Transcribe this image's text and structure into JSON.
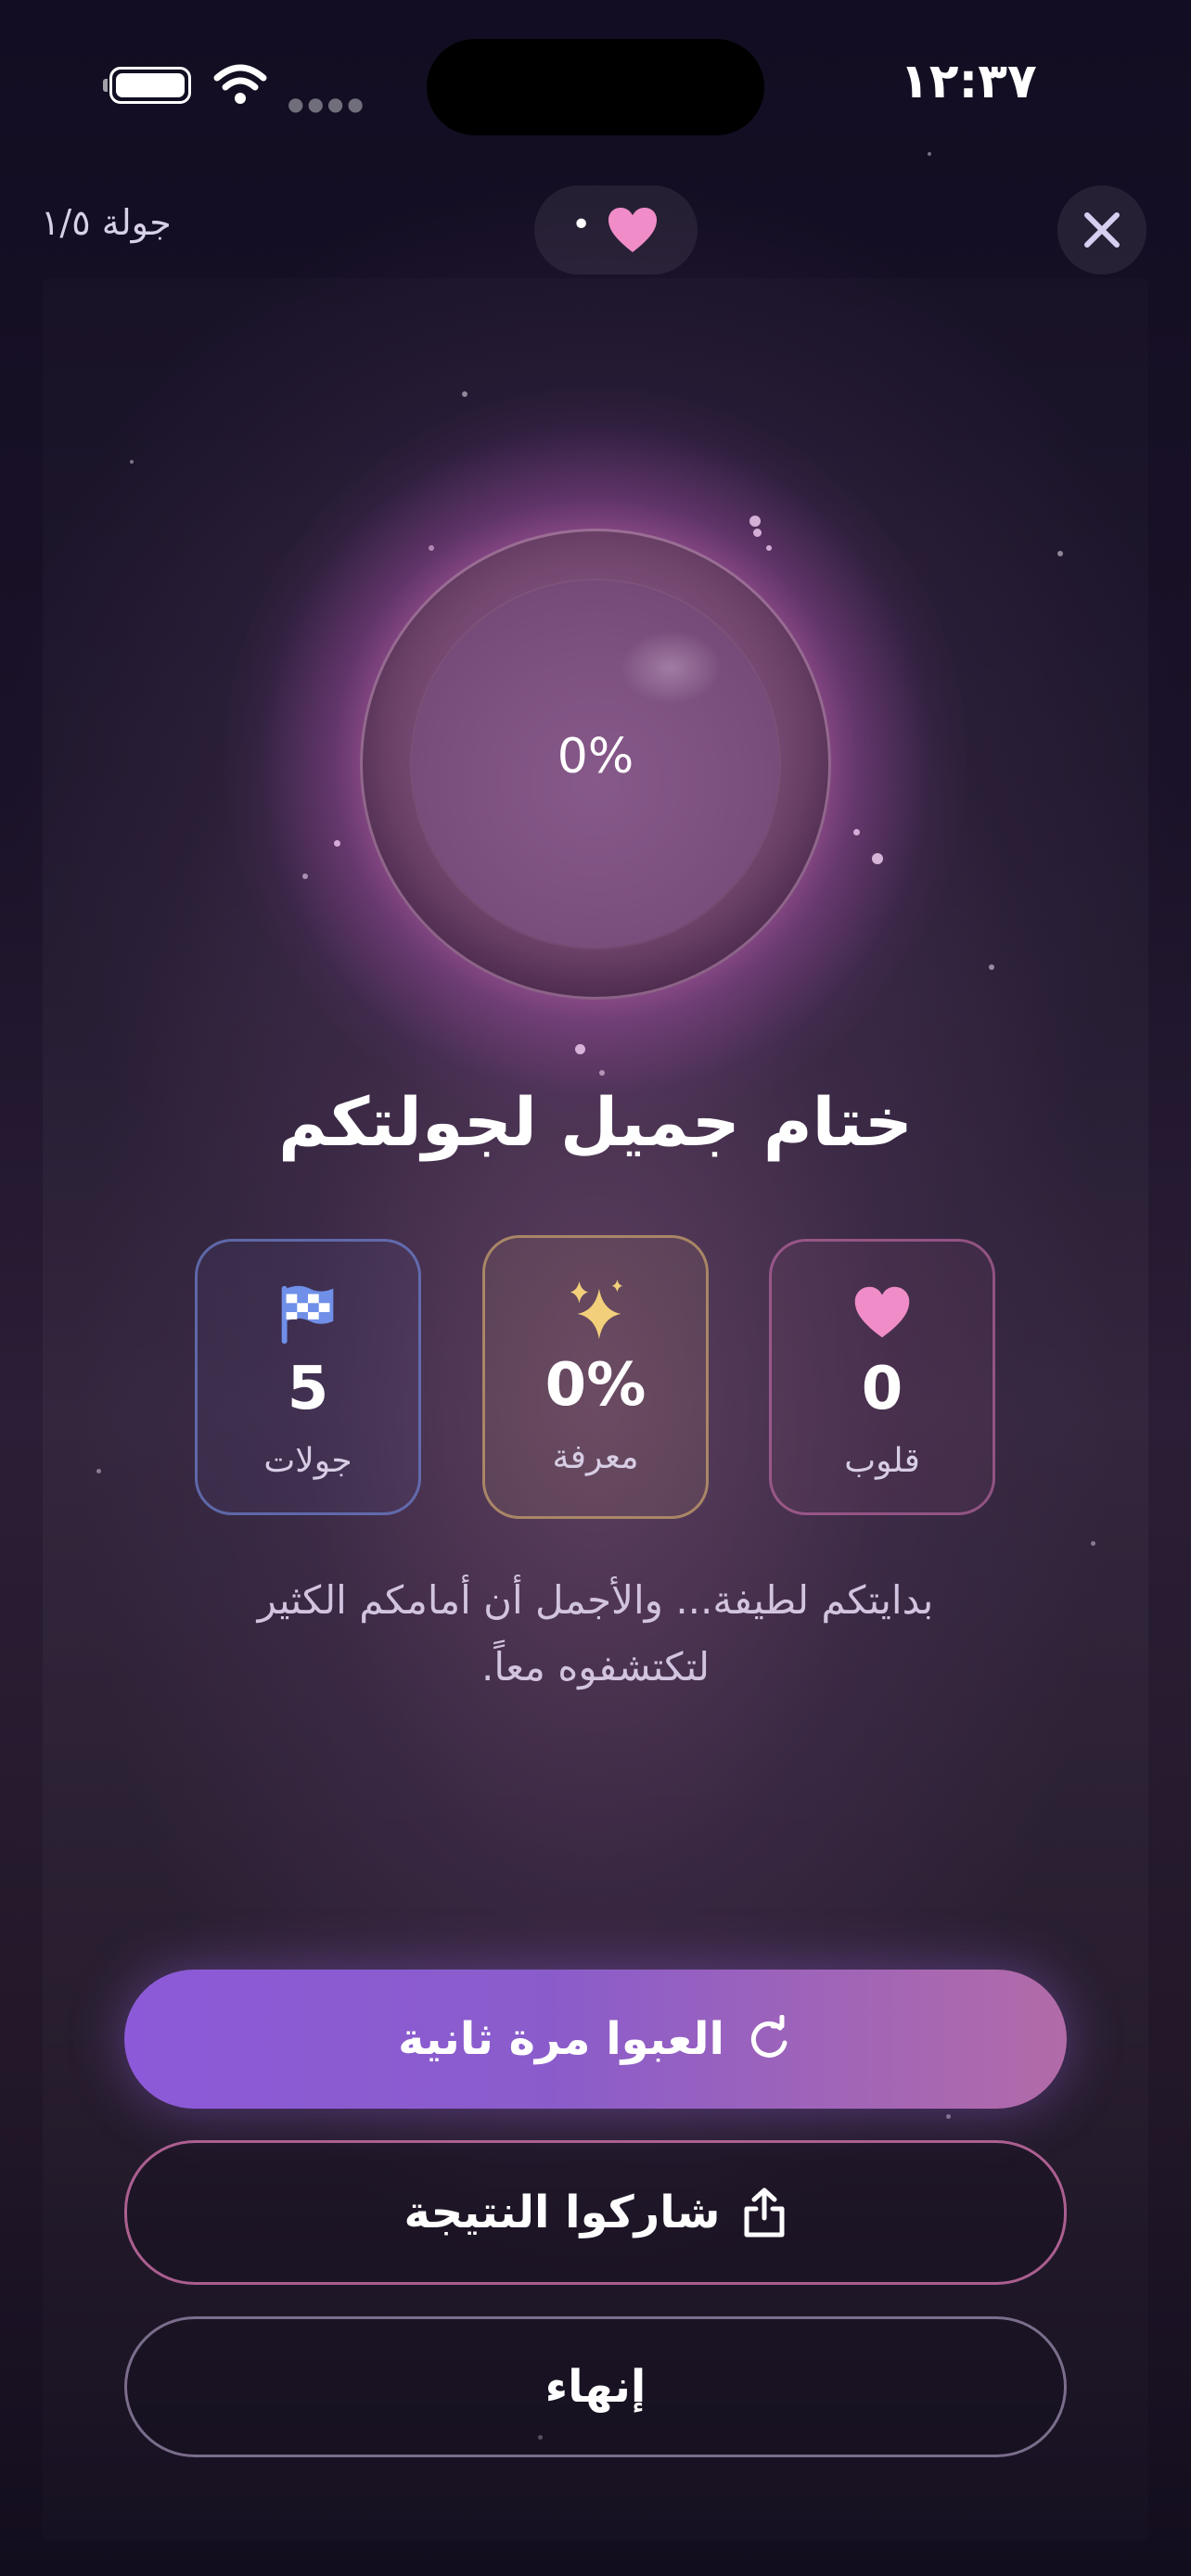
{
  "status_bar": {
    "time": "١٢:٣٧"
  },
  "header": {
    "round_label": "جولة ١/٥",
    "hearts_indicator": "•"
  },
  "orb": {
    "value": "0%",
    "fill_fraction": 0
  },
  "title": "ختام جميل لجولتكم",
  "stats": [
    {
      "key": "rounds",
      "value": "5",
      "label": "جولات",
      "icon": "checkered-flag-icon"
    },
    {
      "key": "knowledge",
      "value": "0%",
      "label": "معرفة",
      "icon": "sparkles-icon"
    },
    {
      "key": "hearts",
      "value": "0",
      "label": "قلوب",
      "icon": "heart-icon"
    }
  ],
  "message": {
    "line1": "بدايتكم لطيفة... والأجمل أن أمامكم الكثير",
    "line2": "لتكتشفوه معاً."
  },
  "buttons": {
    "play_again": "العبوا مرة ثانية",
    "share": "شاركوا النتيجة",
    "finish": "إنهاء"
  },
  "colors": {
    "accent_purple": "#8c5ad8",
    "accent_pink": "#b26ba8",
    "heart_pink": "#f08cc8",
    "flag_blue": "#6f8fe8",
    "sparkle_gold": "#f2cf7a"
  }
}
